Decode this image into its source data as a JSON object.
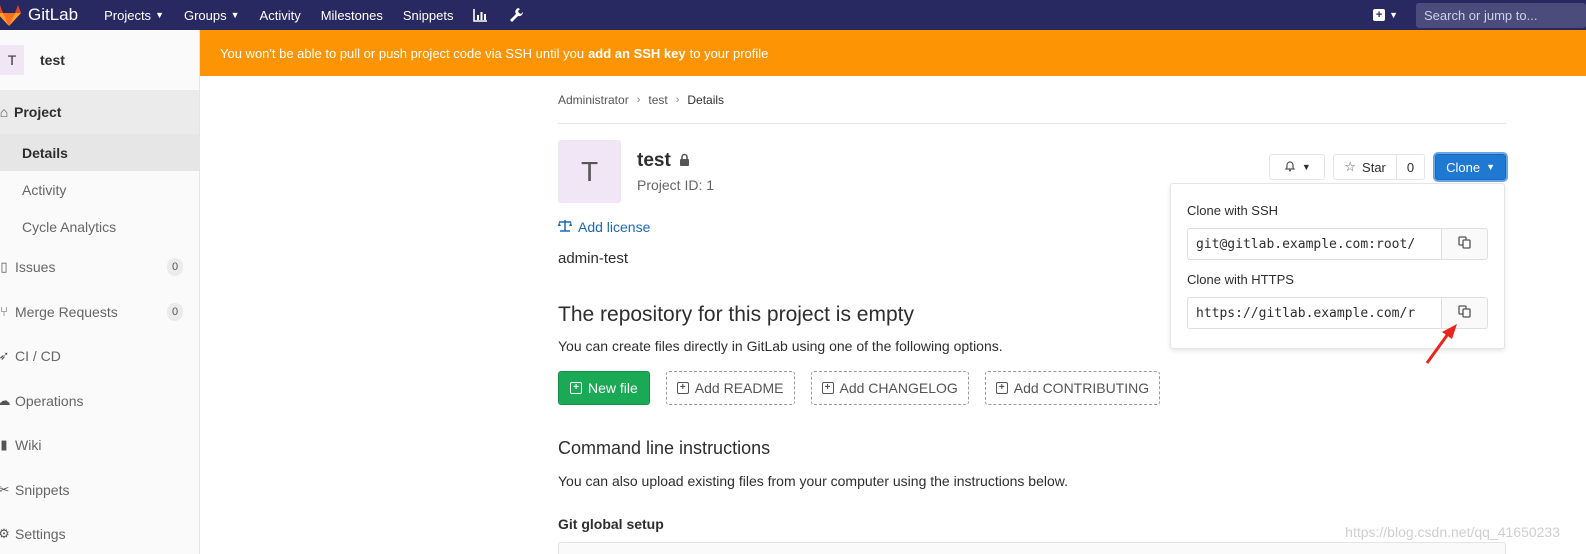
{
  "navbar": {
    "brand": "GitLab",
    "items": [
      {
        "label": "Projects",
        "dropdown": true
      },
      {
        "label": "Groups",
        "dropdown": true
      },
      {
        "label": "Activity",
        "dropdown": false
      },
      {
        "label": "Milestones",
        "dropdown": false
      },
      {
        "label": "Snippets",
        "dropdown": false
      }
    ],
    "search_placeholder": "Search or jump to..."
  },
  "sidebar": {
    "avatar_letter": "T",
    "project_name": "test",
    "section": "Project",
    "sub_items": [
      "Details",
      "Activity",
      "Cycle Analytics"
    ],
    "items": [
      {
        "label": "Issues",
        "count": "0",
        "icon": "issues-icon"
      },
      {
        "label": "Merge Requests",
        "count": "0",
        "icon": "merge-request-icon"
      },
      {
        "label": "CI / CD",
        "count": null,
        "icon": "rocket-icon"
      },
      {
        "label": "Operations",
        "count": null,
        "icon": "cloud-gear-icon"
      },
      {
        "label": "Wiki",
        "count": null,
        "icon": "book-icon"
      },
      {
        "label": "Snippets",
        "count": null,
        "icon": "scissors-icon"
      },
      {
        "label": "Settings",
        "count": null,
        "icon": "gear-icon"
      }
    ]
  },
  "alert": {
    "before": "You won't be able to pull or push project code via SSH until you",
    "link": "add an SSH key",
    "after": "to your profile"
  },
  "breadcrumb": [
    "Administrator",
    "test",
    "Details"
  ],
  "project": {
    "avatar_letter": "T",
    "title": "test",
    "project_id": "Project ID: 1",
    "add_license": "Add license",
    "description": "admin-test"
  },
  "actions": {
    "star_label": "Star",
    "star_count": "0",
    "clone_label": "Clone"
  },
  "clone_dropdown": {
    "ssh_label": "Clone with SSH",
    "ssh_url": "git@gitlab.example.com:root/",
    "https_label": "Clone with HTTPS",
    "https_url": "https://gitlab.example.com/r"
  },
  "empty_repo": {
    "title": "The repository for this project is empty",
    "subtitle": "You can create files directly in GitLab using one of the following options.",
    "new_file": "New file",
    "add_readme": "Add README",
    "add_changelog": "Add CHANGELOG",
    "add_contributing": "Add CONTRIBUTING"
  },
  "command_line": {
    "title": "Command line instructions",
    "subtitle": "You can also upload existing files from your computer using the instructions below.",
    "git_setup": "Git global setup"
  },
  "watermark": "https://blog.csdn.net/qq_41650233",
  "colors": {
    "navbar": "#292961",
    "alert": "#fc9403",
    "clone_button": "#1f78d1",
    "new_file_button": "#1aaa55",
    "link": "#1b69b6"
  }
}
